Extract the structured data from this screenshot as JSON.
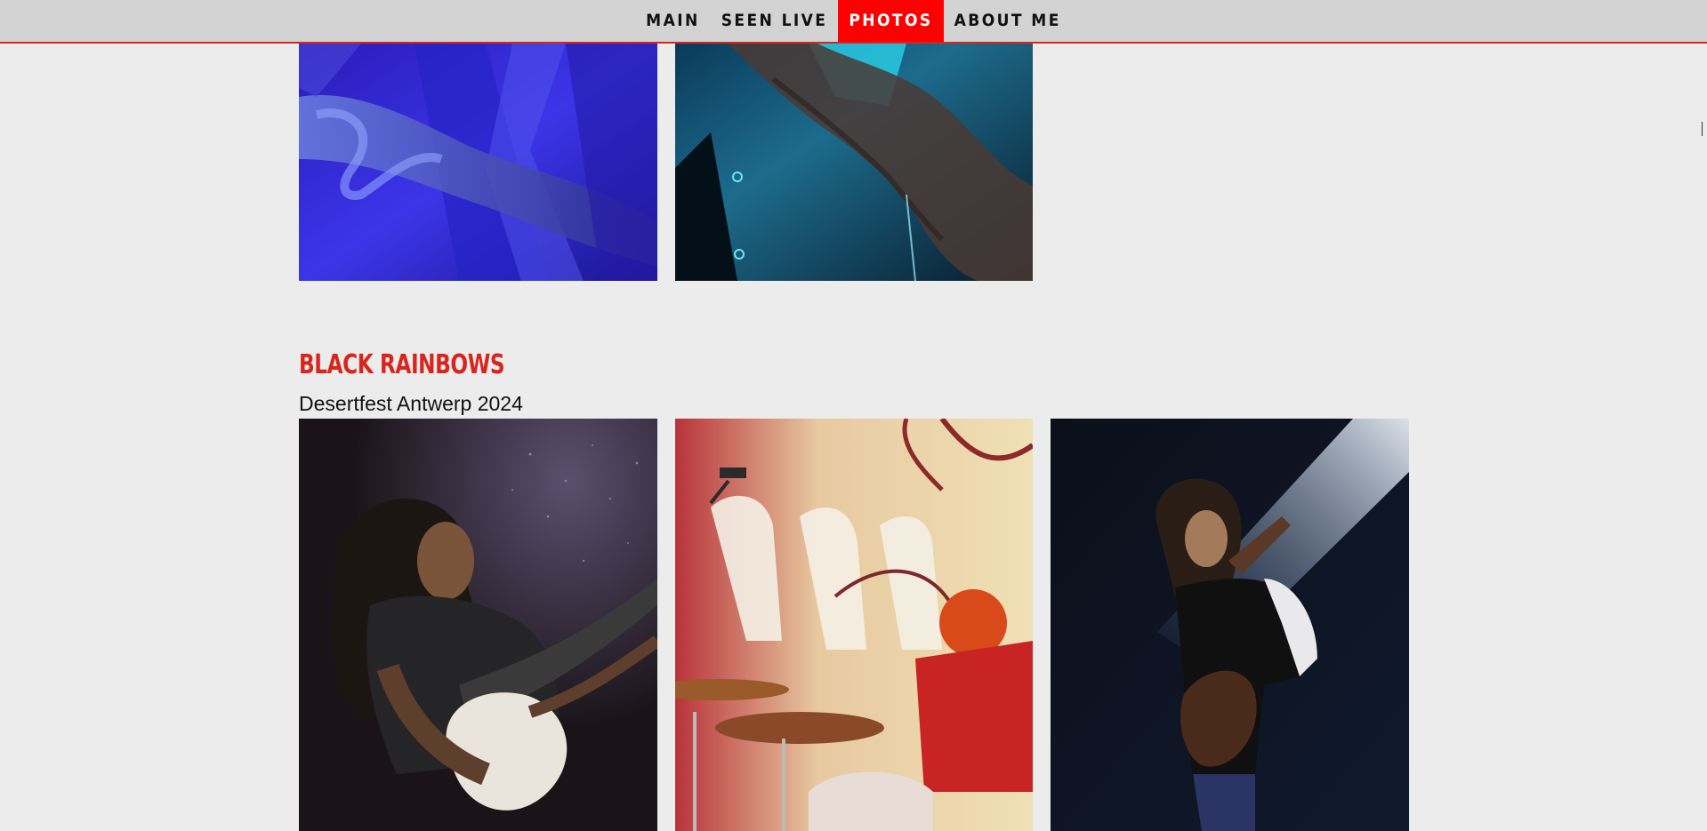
{
  "nav": {
    "items": [
      {
        "label": "MAIN"
      },
      {
        "label": "SEEN LIVE"
      },
      {
        "label": "PHOTOS",
        "active": true
      },
      {
        "label": "ABOUT ME"
      }
    ],
    "accent_color": "#d7261e",
    "active_bg": "#ff0000"
  },
  "gallery_previous": {
    "photos": [
      {
        "subject": "tattooed arm over bass under blue stage light",
        "tone": "blue"
      },
      {
        "subject": "tattooed forearm under cyan stage light",
        "tone": "cyan"
      }
    ]
  },
  "band": {
    "title": "BLACK RAINBOWS",
    "event": "Desertfest Antwerp 2024",
    "photos": [
      {
        "subject": "long-haired bassist playing white bass",
        "tone": "purple-dark"
      },
      {
        "subject": "drummer with red curly hair at drum kit",
        "tone": "red-yellow"
      },
      {
        "subject": "guitarist in spotlight playing guitar",
        "tone": "blue-dark"
      }
    ]
  }
}
